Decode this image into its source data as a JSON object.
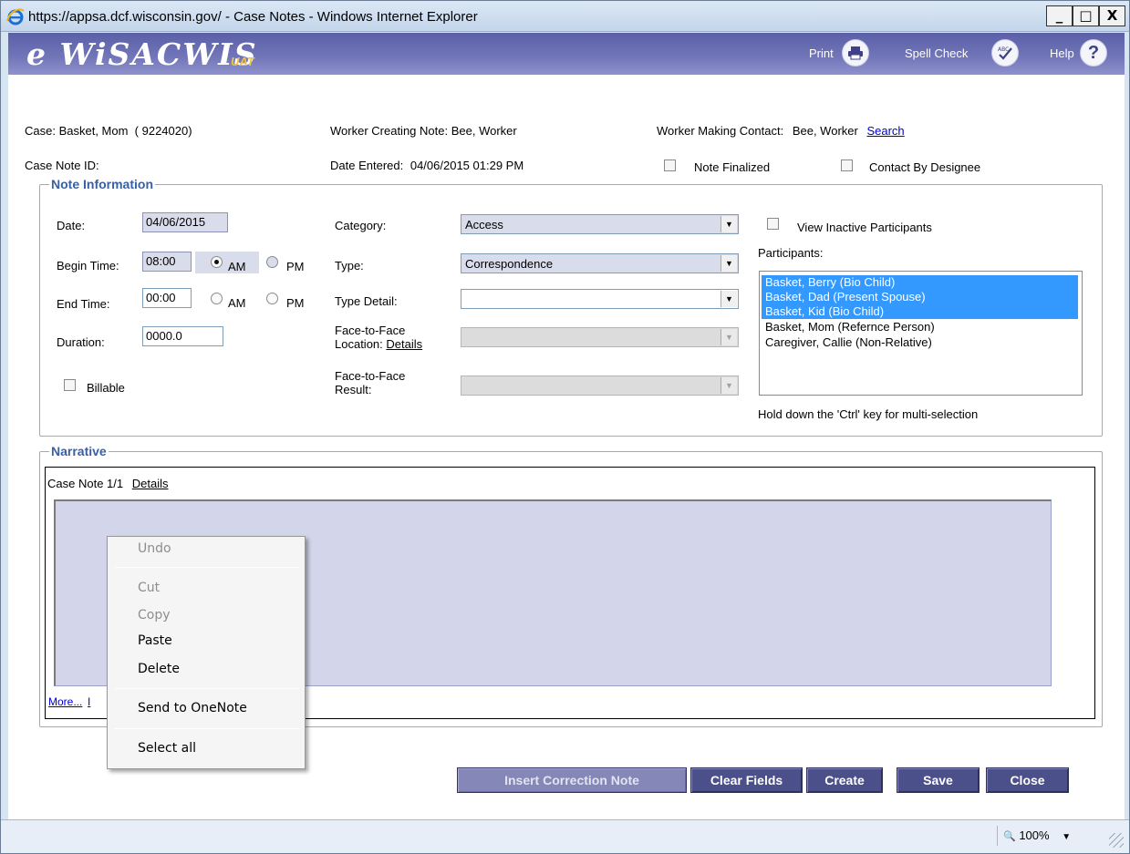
{
  "window": {
    "title": "https://appsa.dcf.wisconsin.gov/ - Case Notes - Windows Internet Explorer",
    "min_glyph": "_",
    "max_glyph": "□",
    "close_glyph": "X"
  },
  "header": {
    "logo": "e WiSACWIS",
    "logo_sub": "UAT",
    "print_label": "Print",
    "spell_check_label": "Spell Check",
    "help_label": "Help",
    "help_glyph": "?"
  },
  "case_info": {
    "case_label": "Case:",
    "case_value": "Basket, Mom  ( 9224020)",
    "worker_creating_label": "Worker Creating Note:",
    "worker_creating_value": "Bee, Worker",
    "worker_contact_label": "Worker Making Contact:",
    "worker_contact_value": "Bee, Worker",
    "search_link": "Search",
    "case_note_id_label": "Case Note ID:",
    "date_entered_label": "Date Entered:",
    "date_entered_value": "04/06/2015 01:29 PM",
    "note_finalized_label": "Note Finalized",
    "contact_by_designee_label": "Contact By Designee"
  },
  "note_info": {
    "legend": "Note Information",
    "date_label": "Date:",
    "date_value": "04/06/2015",
    "begin_time_label": "Begin Time:",
    "begin_time_value": "08:00",
    "am_label": "AM",
    "pm_label": "PM",
    "end_time_label": "End Time:",
    "end_time_value": "00:00",
    "duration_label": "Duration:",
    "duration_value": "0000.0",
    "billable_label": "Billable",
    "category_label": "Category:",
    "category_value": "Access",
    "type_label": "Type:",
    "type_value": "Correspondence",
    "type_detail_label": "Type Detail:",
    "type_detail_value": "",
    "f2f_location_label_1": "Face-to-Face",
    "f2f_location_label_2": "Location:",
    "details_link": "Details",
    "f2f_result_label_1": "Face-to-Face",
    "f2f_result_label_2": "Result:",
    "view_inactive_label": "View Inactive Participants",
    "participants_label": "Participants:",
    "participants": [
      {
        "name": "Basket, Berry (Bio Child)",
        "selected": true
      },
      {
        "name": "Basket, Dad (Present Spouse)",
        "selected": true
      },
      {
        "name": "Basket, Kid (Bio Child)",
        "selected": true
      },
      {
        "name": "Basket, Mom (Refernce Person)",
        "selected": false
      },
      {
        "name": "Caregiver, Callie (Non-Relative)",
        "selected": false
      }
    ],
    "ctrl_hint": "Hold down the 'Ctrl' key for multi-selection"
  },
  "narrative": {
    "legend": "Narrative",
    "case_note_label": "Case Note 1/1",
    "details_link": "Details",
    "more_link": "More...",
    "more_tail": "I"
  },
  "context_menu": {
    "items": [
      "Undo",
      "Cut",
      "Copy",
      "Paste",
      "Delete",
      "Send to OneNote",
      "Select all"
    ]
  },
  "buttons": {
    "insert_correction": "Insert Correction Note",
    "clear_fields": "Clear Fields",
    "create": "Create",
    "save": "Save",
    "close": "Close"
  },
  "statusbar": {
    "zoom": "100%",
    "zoom_glyph": "🔍",
    "dropdown_glyph": "▼"
  },
  "colors": {
    "header_bg": "#6a6eb4",
    "legend_blue": "#3a5fa3",
    "selection_blue": "#3399ff",
    "button_bg": "#4b4f8a",
    "logo_sub": "#f6c23f"
  }
}
